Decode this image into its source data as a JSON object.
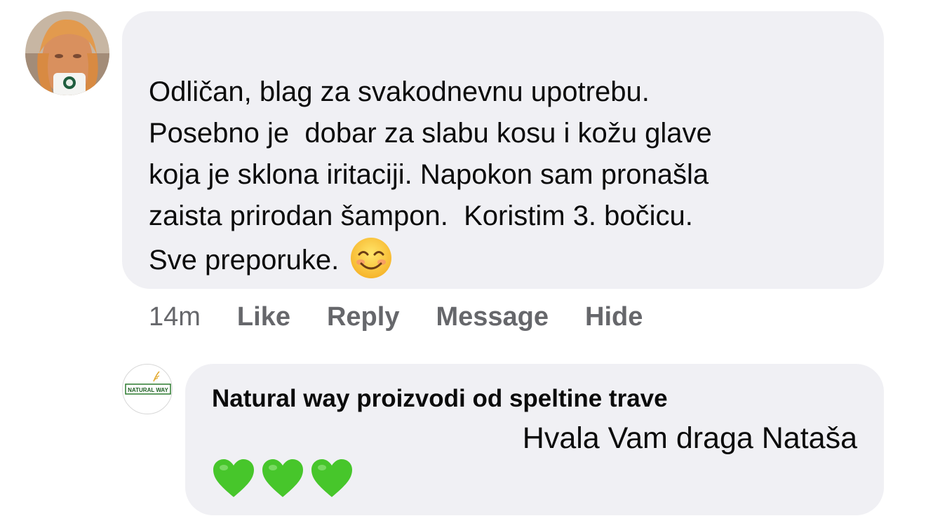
{
  "comment": {
    "lines": [
      "Odličan, blag za svakodnevnu upotrebu.",
      "Posebno je  dobar za slabu kosu i kožu glave",
      "koja je sklona iritaciji. Napokon sam pronašla",
      "zaista prirodan šampon.  Koristim 3. bočicu.",
      "Sve preporuke."
    ],
    "emoji": "smiling-face-icon"
  },
  "actions": {
    "time": "14m",
    "like": "Like",
    "reply": "Reply",
    "message": "Message",
    "hide": "Hide"
  },
  "reply": {
    "author": "Natural way proizvodi od speltine trave",
    "text": "Hvala Vam draga Nataša",
    "emoji": [
      "green-heart-icon",
      "green-heart-icon",
      "green-heart-icon"
    ],
    "page_logo_text": "NATURAL WAY"
  },
  "colors": {
    "bubble": "#f0f0f4",
    "text": "#0b0b0b",
    "secondary": "#66676b",
    "heart": "#47c62b"
  }
}
